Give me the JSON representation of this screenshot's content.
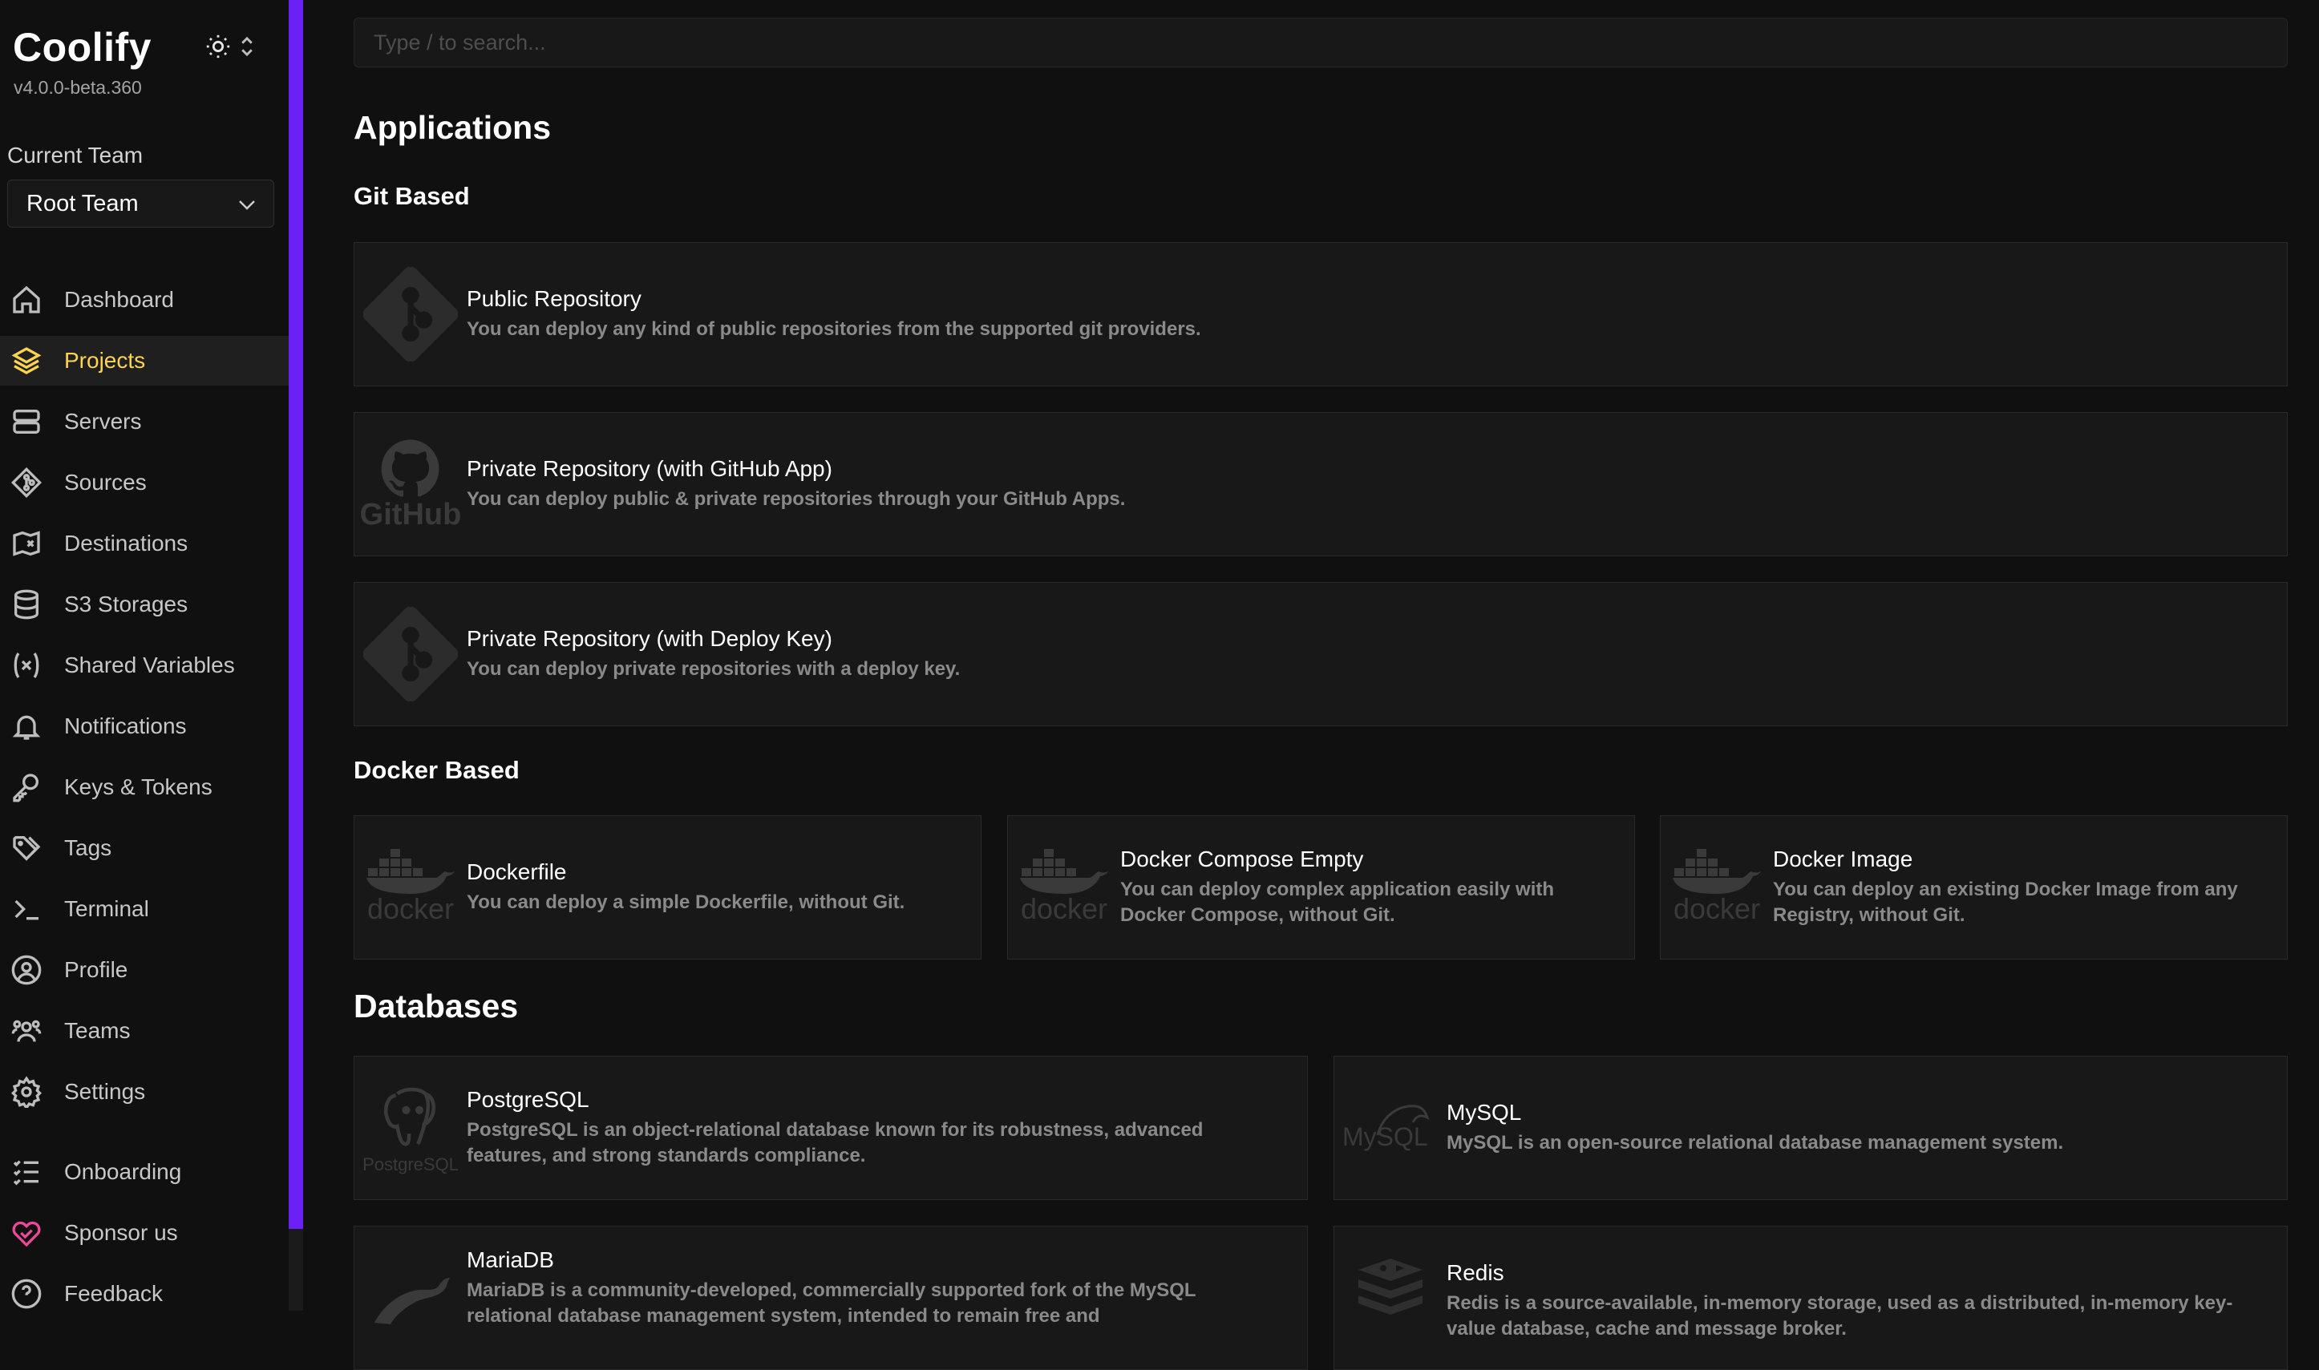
{
  "app": {
    "name": "Coolify",
    "version": "v4.0.0-beta.360"
  },
  "team": {
    "label": "Current Team",
    "selected": "Root Team"
  },
  "nav": [
    {
      "label": "Dashboard",
      "icon": "home-icon"
    },
    {
      "label": "Projects",
      "icon": "layers-icon",
      "active": true
    },
    {
      "label": "Servers",
      "icon": "server-icon"
    },
    {
      "label": "Sources",
      "icon": "git-icon"
    },
    {
      "label": "Destinations",
      "icon": "map-icon"
    },
    {
      "label": "S3 Storages",
      "icon": "database-icon"
    },
    {
      "label": "Shared Variables",
      "icon": "variable-icon"
    },
    {
      "label": "Notifications",
      "icon": "bell-icon"
    },
    {
      "label": "Keys & Tokens",
      "icon": "key-icon"
    },
    {
      "label": "Tags",
      "icon": "tag-icon"
    },
    {
      "label": "Terminal",
      "icon": "terminal-icon"
    },
    {
      "label": "Profile",
      "icon": "user-circle-icon"
    },
    {
      "label": "Teams",
      "icon": "users-icon"
    },
    {
      "label": "Settings",
      "icon": "gear-icon"
    },
    {
      "label": "Onboarding",
      "icon": "checklist-icon"
    },
    {
      "label": "Sponsor us",
      "icon": "heart-icon"
    },
    {
      "label": "Feedback",
      "icon": "help-icon"
    }
  ],
  "search": {
    "placeholder": "Type / to search..."
  },
  "sections": {
    "applications": "Applications",
    "git_based": "Git Based",
    "docker_based": "Docker Based",
    "databases": "Databases"
  },
  "git_cards": [
    {
      "title": "Public Repository",
      "desc": "You can deploy any kind of public repositories from the supported git providers.",
      "logo": "git-logo"
    },
    {
      "title": "Private Repository (with GitHub App)",
      "desc": "You can deploy public & private repositories through your GitHub Apps.",
      "logo": "github-logo"
    },
    {
      "title": "Private Repository (with Deploy Key)",
      "desc": "You can deploy private repositories with a deploy key.",
      "logo": "git-logo"
    }
  ],
  "docker_cards": [
    {
      "title": "Dockerfile",
      "desc": "You can deploy a simple Dockerfile, without Git.",
      "logo": "docker-logo"
    },
    {
      "title": "Docker Compose Empty",
      "desc": "You can deploy complex application easily with Docker Compose, without Git.",
      "logo": "docker-logo"
    },
    {
      "title": "Docker Image",
      "desc": "You can deploy an existing Docker Image from any Registry, without Git.",
      "logo": "docker-logo"
    }
  ],
  "db_cards": [
    {
      "title": "PostgreSQL",
      "desc": "PostgreSQL is an object-relational database known for its robustness, advanced features, and strong standards compliance.",
      "logo": "postgresql-logo"
    },
    {
      "title": "MySQL",
      "desc": "MySQL is an open-source relational database management system.",
      "logo": "mysql-logo"
    },
    {
      "title": "MariaDB",
      "desc": "MariaDB is a community-developed, commercially supported fork of the MySQL relational database management system, intended to remain free and",
      "logo": "mariadb-logo"
    },
    {
      "title": "Redis",
      "desc": "Redis is a source-available, in-memory storage, used as a distributed, in-memory key-value database, cache and message broker.",
      "logo": "redis-logo"
    }
  ],
  "logo_text": {
    "github": "GitHub",
    "docker": "docker",
    "postgresql": "PostgreSQL",
    "mysql": "MySQL"
  },
  "colors": {
    "accent": "#6b21f5",
    "active_nav": "#fcd452",
    "sponsor": "#ec4899"
  }
}
